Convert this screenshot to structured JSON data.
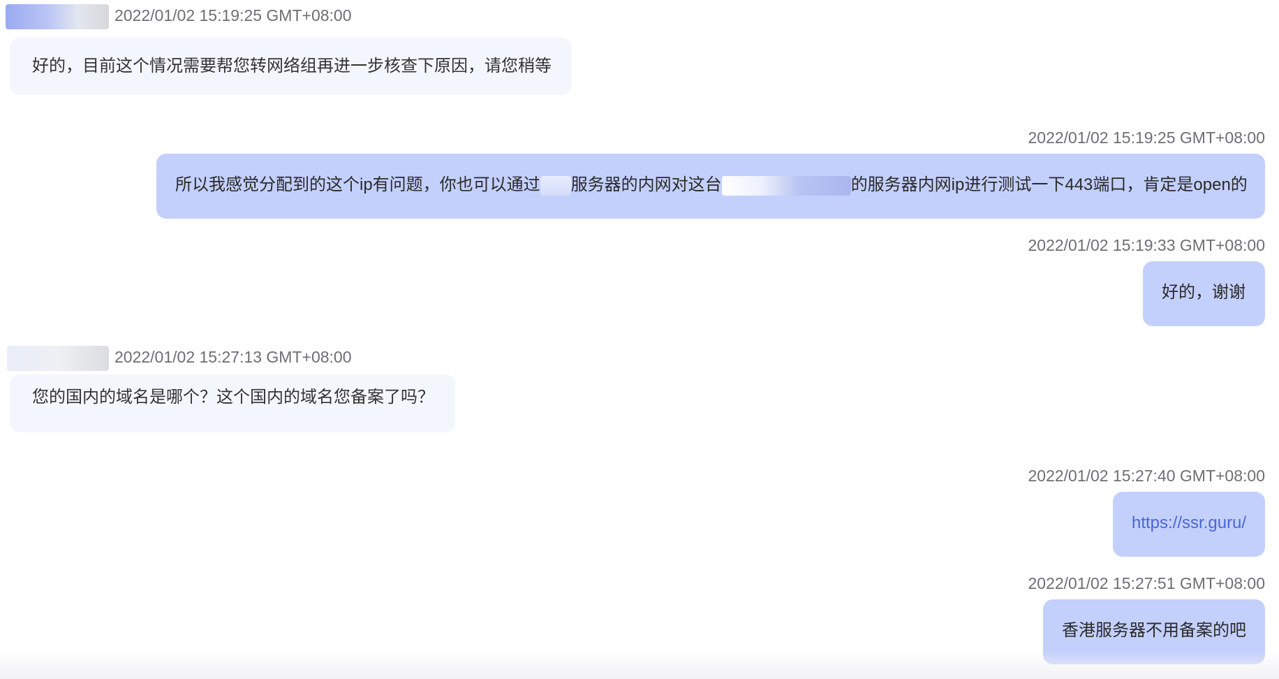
{
  "messages": [
    {
      "side": "incoming",
      "timestamp": "2022/01/02 15:19:25 GMT+08:00",
      "text": "好的，目前这个情况需要帮您转网络组再进一步核查下原因，请您稍等"
    },
    {
      "side": "outgoing",
      "timestamp": "2022/01/02 15:19:25 GMT+08:00",
      "text_part1": "所以我感觉分配到的这个ip有问题，你也可以通过",
      "text_part2": "服务器的内网对这台",
      "text_part3": "的服务器内网ip进行测试一下443端口，肯定是open的"
    },
    {
      "side": "outgoing",
      "timestamp": "2022/01/02 15:19:33 GMT+08:00",
      "text": "好的，谢谢"
    },
    {
      "side": "incoming",
      "timestamp": "2022/01/02 15:27:13 GMT+08:00",
      "text": "您的国内的域名是哪个？这个国内的域名您备案了吗？"
    },
    {
      "side": "outgoing",
      "timestamp": "2022/01/02 15:27:40 GMT+08:00",
      "link": "https://ssr.guru/"
    },
    {
      "side": "outgoing",
      "timestamp": "2022/01/02 15:27:51 GMT+08:00",
      "text": "香港服务器不用备案的吧"
    }
  ],
  "colors": {
    "incoming_bubble": "#f4f6fe",
    "outgoing_bubble": "#c4d0fc",
    "timestamp": "#6e6e73",
    "link": "#4a66d6"
  }
}
